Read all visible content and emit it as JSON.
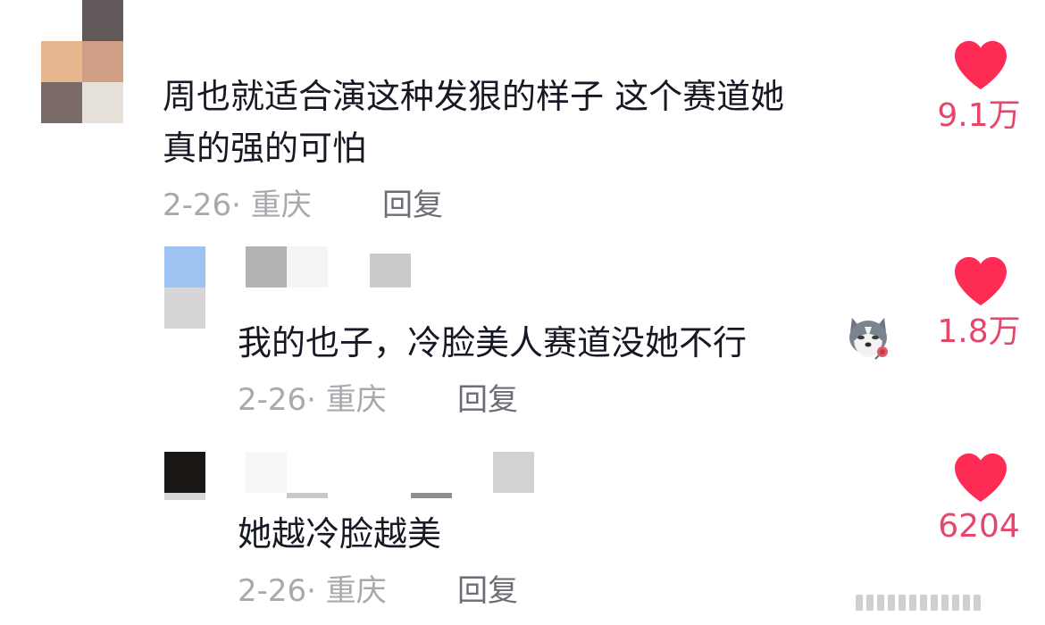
{
  "comments": [
    {
      "text_line1": "周也就适合演这种发狠的样子 这个赛道她",
      "text_line2": "真的强的可怕",
      "date_location": "2-26· 重庆",
      "reply_label": "回复",
      "likes": "9.1万"
    },
    {
      "text": "我的也子，冷脸美人赛道没她不行",
      "emoji": "husky-with-rose-icon",
      "date_location": "2-26· 重庆",
      "reply_label": "回复",
      "likes": "1.8万"
    },
    {
      "text": "她越冷脸越美",
      "date_location": "2-26· 重庆",
      "reply_label": "回复",
      "likes": "6204"
    }
  ],
  "colors": {
    "text": "#161823",
    "meta": "#a7a9ad",
    "reply": "#6b6e75",
    "like": "#fe2c55",
    "like_count": "#e6466a"
  }
}
